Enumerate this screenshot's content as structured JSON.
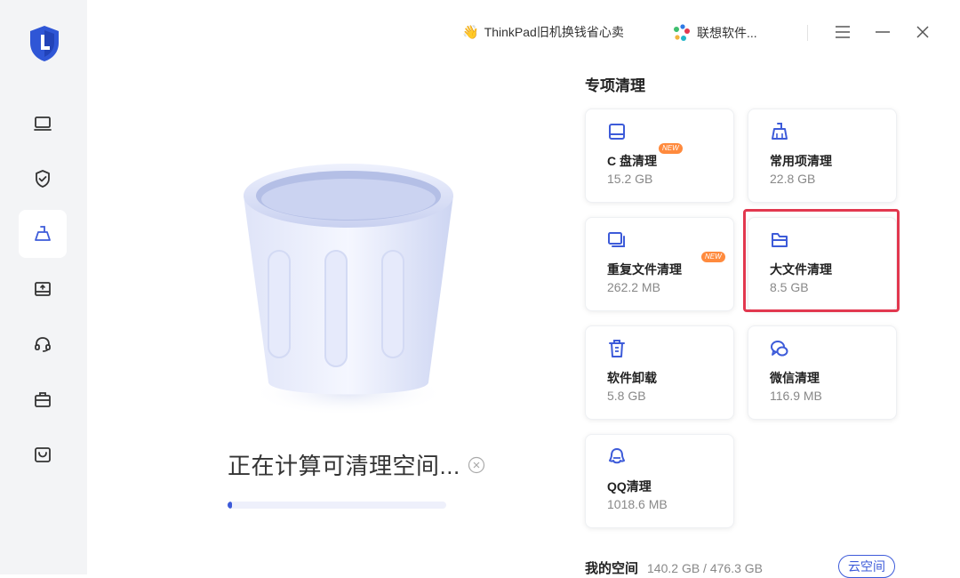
{
  "topbar": {
    "promo_text": "ThinkPad旧机换钱省心卖",
    "software_text": "联想软件...",
    "menu_icon": "menu-icon",
    "minimize_icon": "minimize-icon",
    "close_icon": "close-icon"
  },
  "sidebar": {
    "logo": "shield-logo",
    "items": [
      {
        "icon": "laptop-icon",
        "active": false
      },
      {
        "icon": "shield-check-icon",
        "active": false
      },
      {
        "icon": "broom-icon",
        "active": true
      },
      {
        "icon": "drive-icon",
        "active": false
      },
      {
        "icon": "headset-icon",
        "active": false
      },
      {
        "icon": "briefcase-icon",
        "active": false
      },
      {
        "icon": "shopping-bag-icon",
        "active": false
      }
    ]
  },
  "main": {
    "status_text": "正在计算可清理空间...",
    "progress": 0.02
  },
  "panel": {
    "section_title": "专项清理",
    "cards": [
      {
        "title": "C 盘清理",
        "size": "15.2 GB",
        "icon": "drive-icon",
        "badge": "NEW"
      },
      {
        "title": "常用项清理",
        "size": "22.8 GB",
        "icon": "broom-icon",
        "badge": ""
      },
      {
        "title": "重复文件清理",
        "size": "262.2 MB",
        "icon": "duplicate-files-icon",
        "badge": "NEW"
      },
      {
        "title": "大文件清理",
        "size": "8.5 GB",
        "icon": "folder-icon",
        "badge": ""
      },
      {
        "title": "软件卸载",
        "size": "5.8 GB",
        "icon": "trash-icon",
        "badge": ""
      },
      {
        "title": "微信清理",
        "size": "116.9 MB",
        "icon": "wechat-icon",
        "badge": ""
      },
      {
        "title": "QQ清理",
        "size": "1018.6 MB",
        "icon": "qq-icon",
        "badge": ""
      }
    ],
    "myspace_label": "我的空间",
    "myspace_value": "140.2 GB / 476.3 GB",
    "cloud_button": "云空间"
  },
  "colors": {
    "accent": "#3d5bd9",
    "highlight": "#e2384f",
    "new_badge": "#ff8a3d",
    "sidebar_bg": "#f3f4f6"
  }
}
